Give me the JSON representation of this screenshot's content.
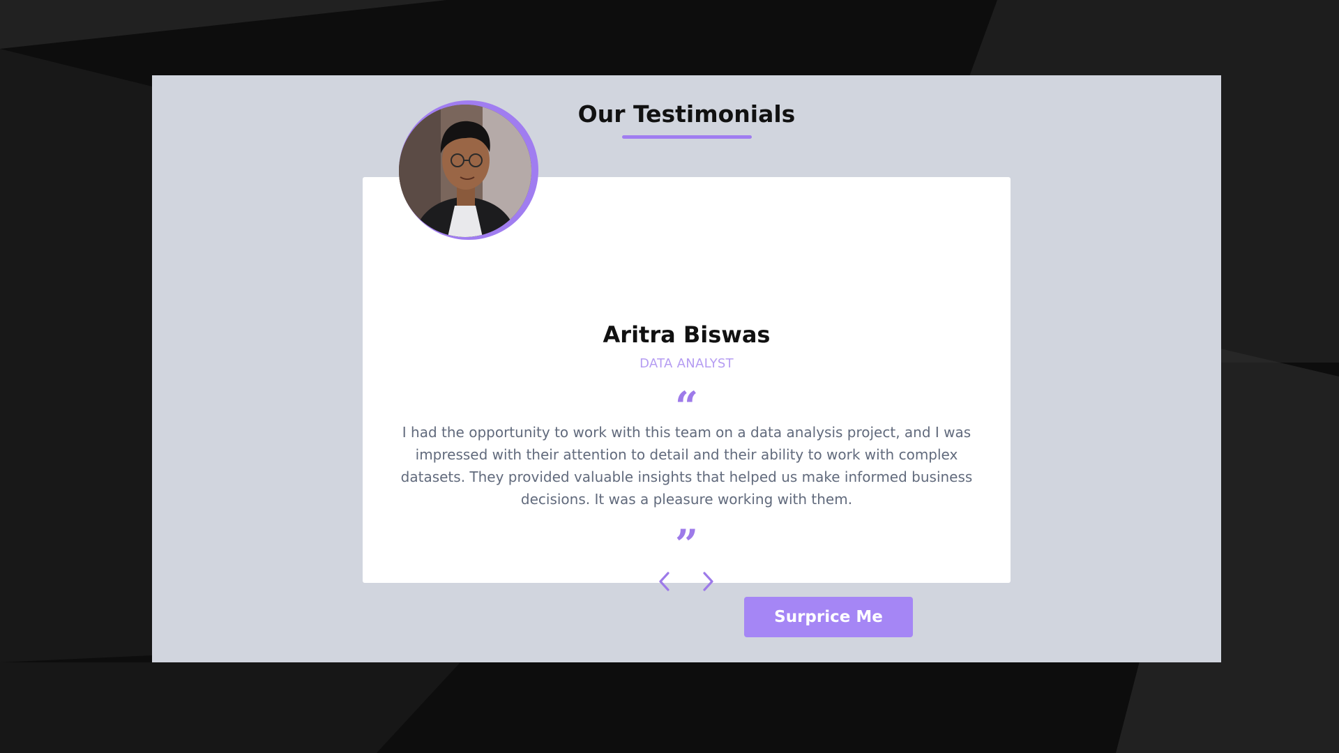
{
  "section": {
    "title": "Our Testimonials"
  },
  "testimonial": {
    "name": "Aritra Biswas",
    "role": "DATA ANALYST",
    "quote_open": "“",
    "quote_close": "”",
    "text": "I had the opportunity to work with this team on a data analysis project, and I was impressed with their attention to detail and their ability to work with complex datasets. They provided valuable insights that helped us make informed business decisions. It was a pleasure working with them."
  },
  "controls": {
    "prev_icon": "chevron-left-icon",
    "next_icon": "chevron-right-icon",
    "surprise_label": "Surprice Me"
  },
  "colors": {
    "accent": "#a07df0",
    "button": "#a586f5",
    "role_text": "#b59cf2",
    "body_text": "#616a7c",
    "frame_bg": "#d1d5de",
    "card_bg": "#ffffff"
  }
}
